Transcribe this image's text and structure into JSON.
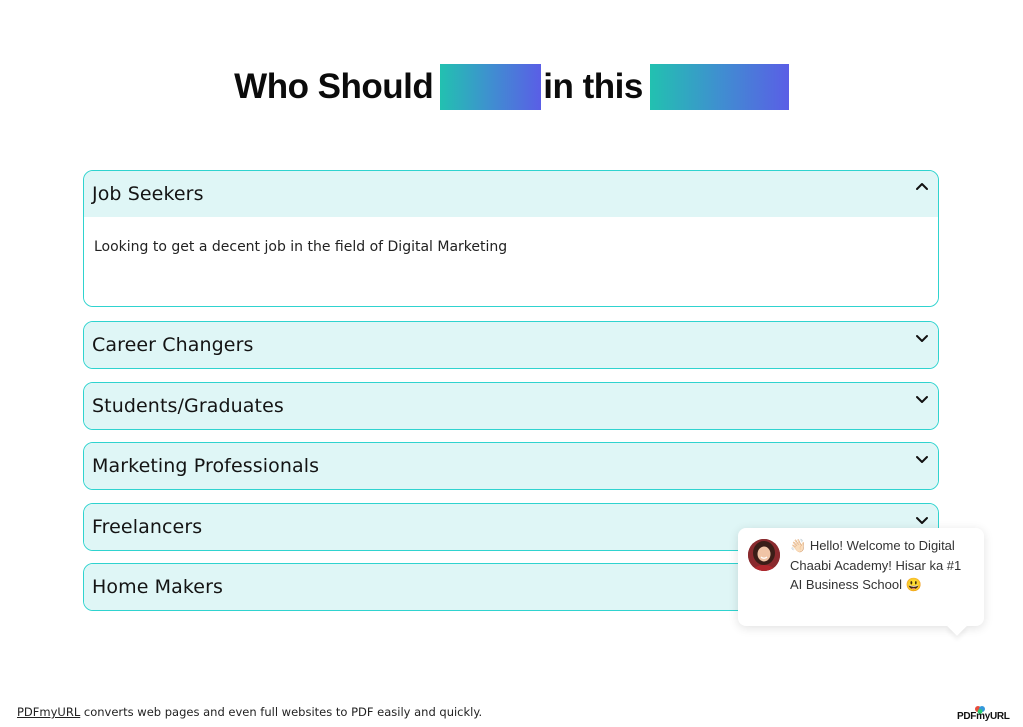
{
  "heading": {
    "part1": "Who Should",
    "part2": "in this"
  },
  "accordion": [
    {
      "label": "Job Seekers",
      "expanded": true,
      "body": "Looking to get a decent job in the field of Digital Marketing",
      "icon": "chevron-up-icon"
    },
    {
      "label": "Career Changers",
      "expanded": false,
      "icon": "chevron-down-icon"
    },
    {
      "label": "Students/Graduates",
      "expanded": false,
      "icon": "chevron-down-icon"
    },
    {
      "label": "Marketing Professionals",
      "expanded": false,
      "icon": "chevron-down-icon"
    },
    {
      "label": "Freelancers",
      "expanded": false,
      "icon": "chevron-down-icon"
    },
    {
      "label": "Home Makers",
      "expanded": false,
      "icon": "chevron-down-icon"
    }
  ],
  "chat": {
    "wave": "👋🏻",
    "message": "Hello! Welcome to Digital Chaabi Academy! Hisar ka #1 AI Business School",
    "smile": "😃"
  },
  "footer": {
    "link": "PDFmyURL",
    "text": " converts web pages and even full websites to PDF easily and quickly.",
    "logo": "PDFmyURL"
  },
  "colors": {
    "accent_border": "#2fd3cf",
    "item_bg": "#dff6f6",
    "gradient_start": "#22c1b0",
    "gradient_end": "#5a5ee6"
  }
}
